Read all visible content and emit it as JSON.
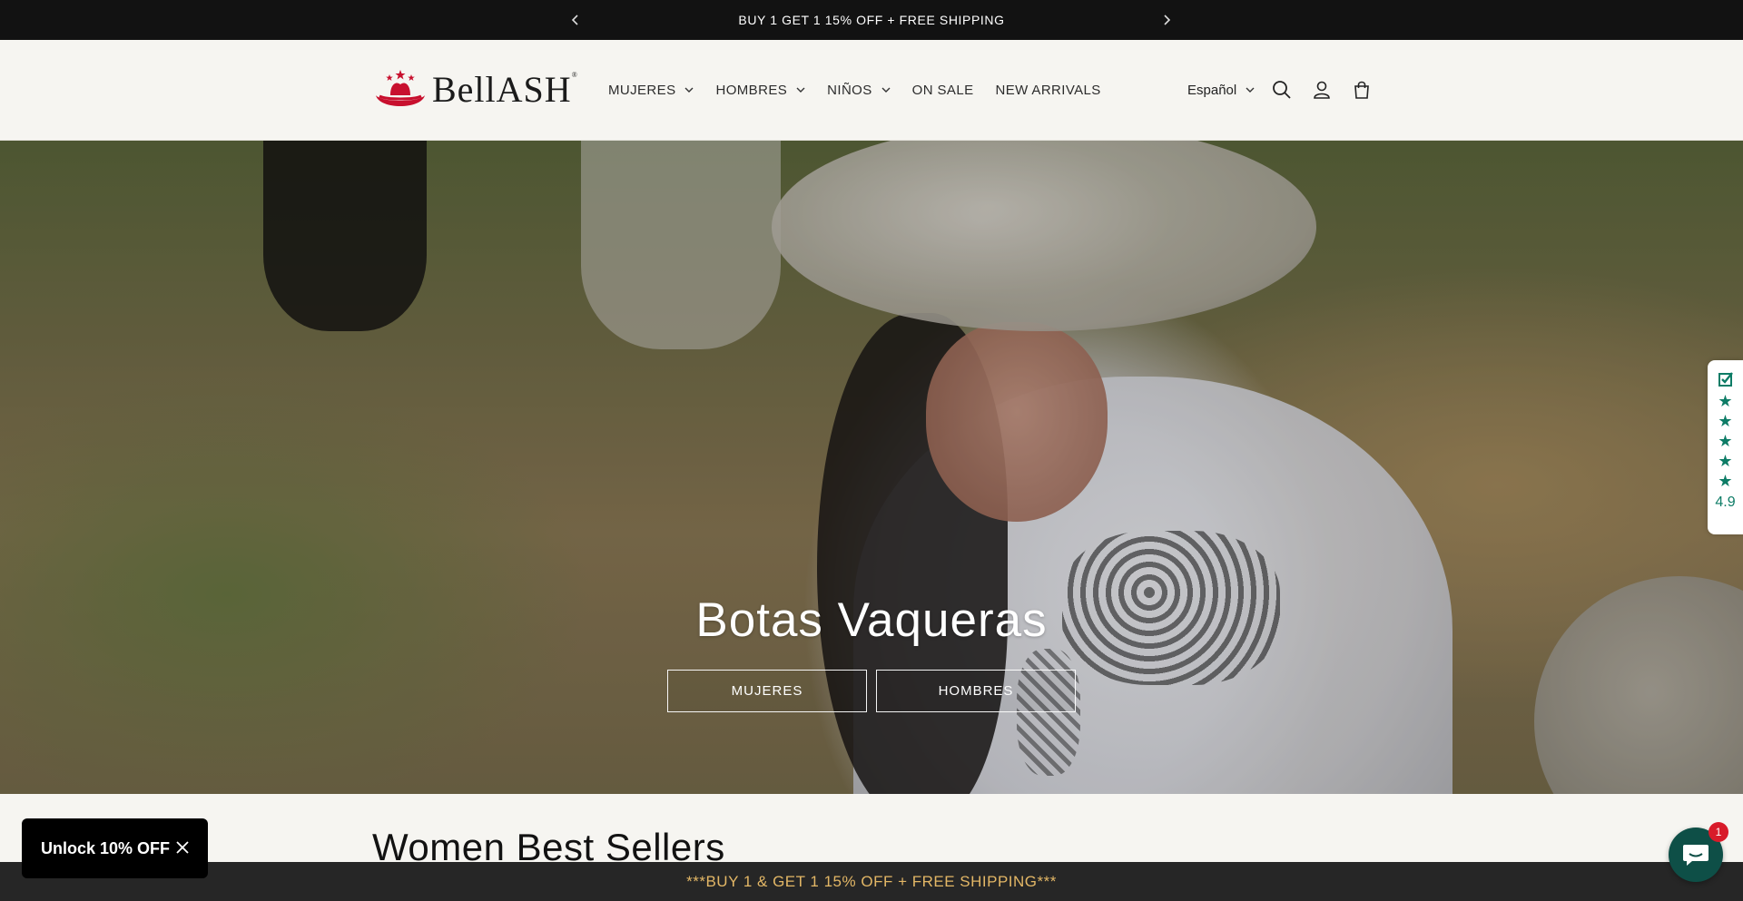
{
  "announcement": {
    "text": "BUY 1 GET 1 15% OFF + FREE SHIPPING",
    "prev_icon": "chevron-left-icon",
    "next_icon": "chevron-right-icon"
  },
  "header": {
    "logo_text": "BellASH",
    "logo_reg": "®",
    "nav": [
      {
        "label": "MUJERES",
        "dropdown": true
      },
      {
        "label": "HOMBRES",
        "dropdown": true
      },
      {
        "label": "NIÑOS",
        "dropdown": true
      },
      {
        "label": "ON SALE",
        "dropdown": false
      },
      {
        "label": "NEW ARRIVALS",
        "dropdown": false
      }
    ],
    "language": "Español",
    "icons": [
      "search-icon",
      "account-icon",
      "cart-icon"
    ]
  },
  "hero": {
    "title": "Botas Vaqueras",
    "buttons": [
      "MUJERES",
      "HOMBRES"
    ]
  },
  "reviews_widget": {
    "rating": "4.9",
    "stars": 5,
    "star_glyph": "★"
  },
  "section": {
    "title": "Women Best Sellers"
  },
  "popup": {
    "label": "Unlock 10% OFF"
  },
  "bottom_bar": {
    "text": "***BUY 1 & GET 1 15% OFF + FREE SHIPPING***"
  },
  "chat": {
    "badge_count": "1"
  },
  "colors": {
    "announcement_bg": "#121212",
    "page_bg": "#f6f5f1",
    "reviews_accent": "#0d7c66",
    "bottom_bar_text": "#e3b766",
    "chat_bg": "#0e4f47",
    "logo_red": "#c8102e"
  }
}
